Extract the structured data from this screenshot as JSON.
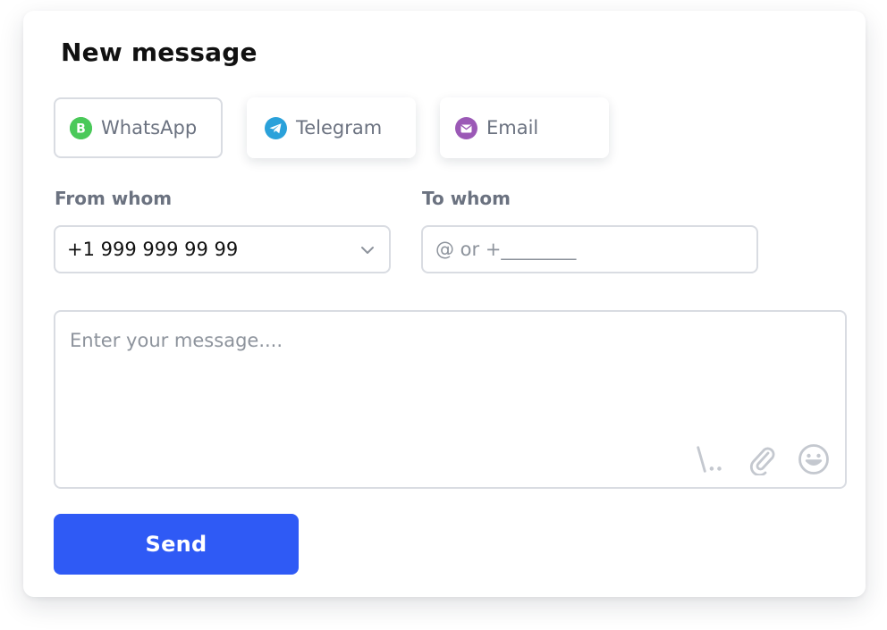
{
  "window": {
    "title": "New message"
  },
  "channels": [
    {
      "label": "WhatsApp",
      "icon": "whatsapp-icon",
      "color": "#4ac959",
      "selected": true
    },
    {
      "label": "Telegram",
      "icon": "telegram-icon",
      "color": "#2aa1da",
      "selected": false
    },
    {
      "label": "Email",
      "icon": "email-icon",
      "color": "#9b59b6",
      "selected": false
    }
  ],
  "from": {
    "label": "From whom",
    "value": "+1 999 999 99 99",
    "icon": "chevron-down-icon"
  },
  "to": {
    "label": "To whom",
    "placeholder": "@ or +________"
  },
  "message": {
    "placeholder": "Enter your message....",
    "tools": [
      "command-icon",
      "paperclip-icon",
      "smiley-icon"
    ]
  },
  "send": {
    "label": "Send"
  },
  "colors": {
    "accent": "#2f5af5",
    "border": "#d9dce2",
    "muted_text": "#6b7280"
  }
}
